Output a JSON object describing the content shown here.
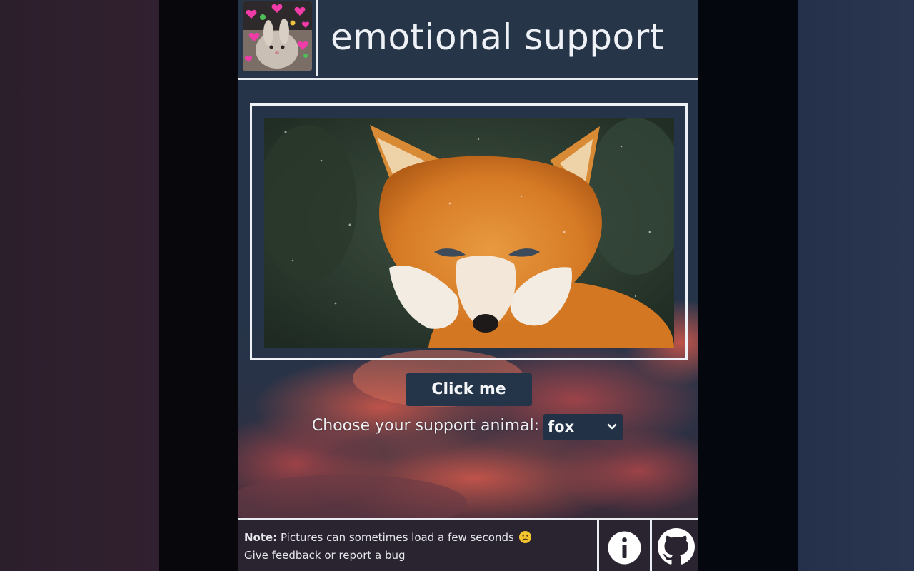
{
  "header": {
    "title": "emotional support",
    "logo_icon": "bunny-with-hearts-icon"
  },
  "photo": {
    "subject": "fox",
    "icon": "fox-photo"
  },
  "actions": {
    "click_label": "Click me"
  },
  "chooser": {
    "label": "Choose your support animal:",
    "selected": "fox"
  },
  "footer": {
    "note_bold": "Note:",
    "note_text": " Pictures can sometimes load a few seconds",
    "feedback_text": "Give feedback or report a bug",
    "info_icon": "info-icon",
    "github_icon": "github-icon"
  },
  "colors": {
    "panel": "#263449",
    "button": "#243449",
    "border": "#e9edf2",
    "footer": "#2a2330"
  }
}
